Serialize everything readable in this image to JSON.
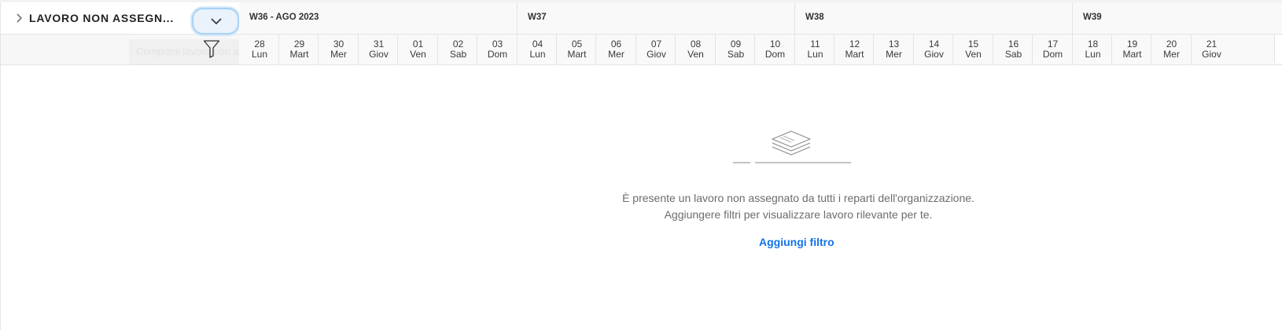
{
  "panel": {
    "title": "LAVORO NON ASSEGN...",
    "tooltip": "Comprimi lavoro non assegnato"
  },
  "weeks": [
    {
      "label": "W36 - AGO 2023"
    },
    {
      "label": "W37"
    },
    {
      "label": "W38"
    },
    {
      "label": "W39"
    }
  ],
  "days": [
    {
      "num": "28",
      "name": "Lun"
    },
    {
      "num": "29",
      "name": "Mart"
    },
    {
      "num": "30",
      "name": "Mer"
    },
    {
      "num": "31",
      "name": "Giov"
    },
    {
      "num": "01",
      "name": "Ven"
    },
    {
      "num": "02",
      "name": "Sab"
    },
    {
      "num": "03",
      "name": "Dom"
    },
    {
      "num": "04",
      "name": "Lun"
    },
    {
      "num": "05",
      "name": "Mart"
    },
    {
      "num": "06",
      "name": "Mer"
    },
    {
      "num": "07",
      "name": "Giov"
    },
    {
      "num": "08",
      "name": "Ven"
    },
    {
      "num": "09",
      "name": "Sab"
    },
    {
      "num": "10",
      "name": "Dom"
    },
    {
      "num": "11",
      "name": "Lun"
    },
    {
      "num": "12",
      "name": "Mart"
    },
    {
      "num": "13",
      "name": "Mer"
    },
    {
      "num": "14",
      "name": "Giov"
    },
    {
      "num": "15",
      "name": "Ven"
    },
    {
      "num": "16",
      "name": "Sab"
    },
    {
      "num": "17",
      "name": "Dom"
    },
    {
      "num": "18",
      "name": "Lun"
    },
    {
      "num": "19",
      "name": "Mart"
    },
    {
      "num": "20",
      "name": "Mer"
    },
    {
      "num": "21",
      "name": "Giov"
    }
  ],
  "empty_state": {
    "line1": "È presente un lavoro non assegnato da tutti i reparti dell'organizzazione.",
    "line2": "Aggiungere filtri per visualizzare lavoro rilevante per te.",
    "action": "Aggiungi filtro"
  },
  "colors": {
    "accent": "#1473e6",
    "focus_ring": "#a9d1f5"
  }
}
